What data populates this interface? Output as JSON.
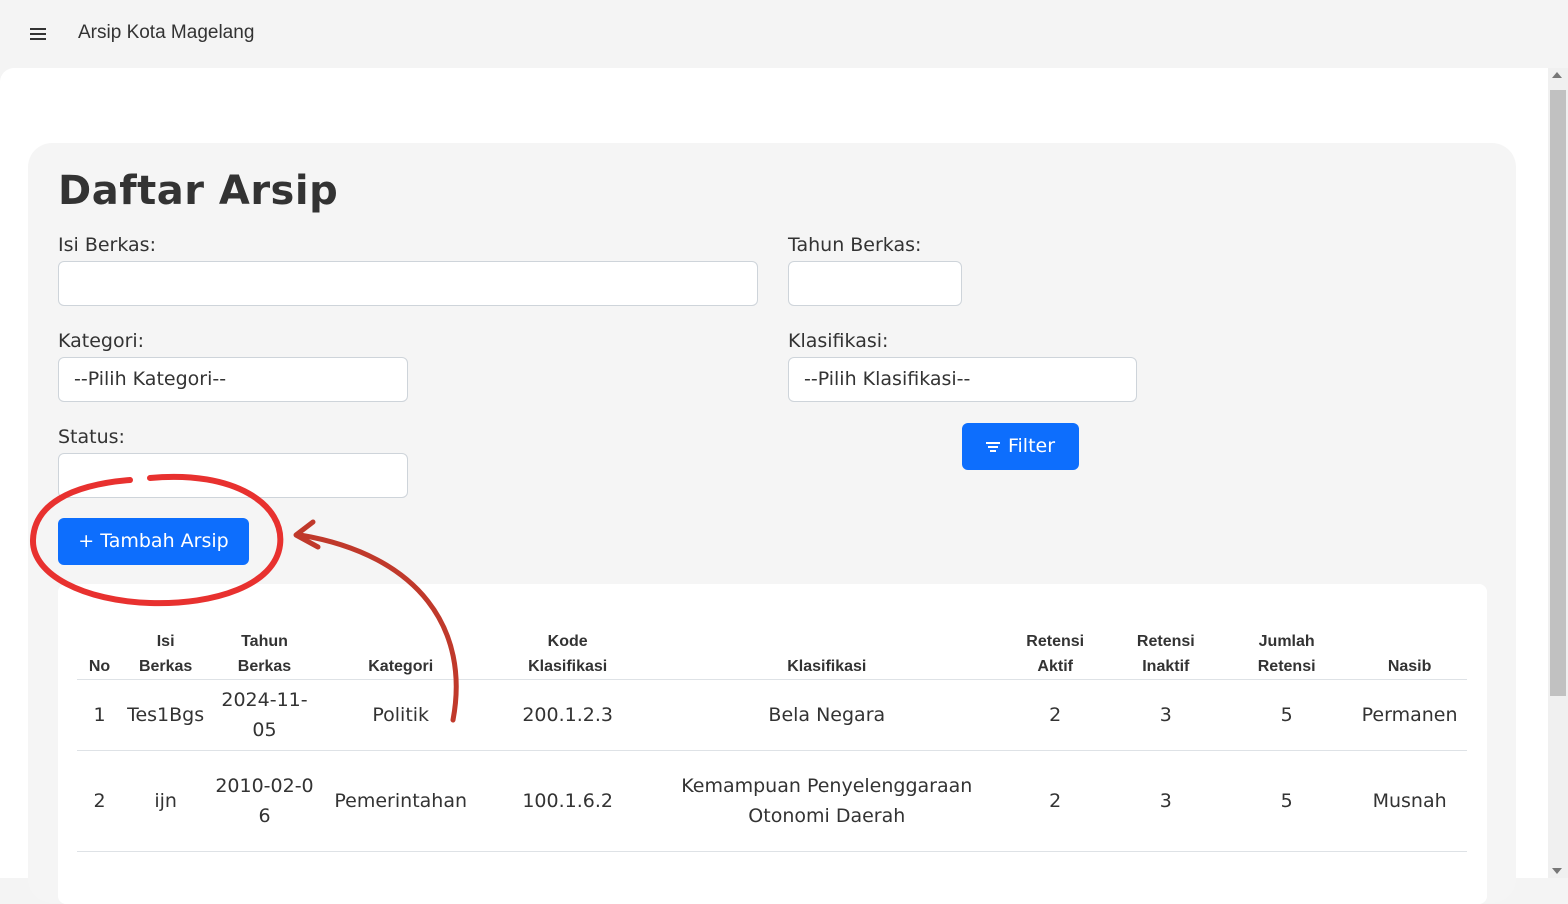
{
  "app": {
    "title": "Arsip Kota Magelang",
    "menu_icon": "hamburger-menu-icon"
  },
  "page": {
    "title": "Daftar Arsip"
  },
  "filters": {
    "isi_berkas": {
      "label": "Isi Berkas:",
      "value": ""
    },
    "tahun_berkas": {
      "label": "Tahun Berkas:",
      "value": ""
    },
    "kategori": {
      "label": "Kategori:",
      "selected": "--Pilih Kategori--"
    },
    "klasifikasi": {
      "label": "Klasifikasi:",
      "selected": "--Pilih Klasifikasi--"
    },
    "status": {
      "label": "Status:",
      "value": ""
    },
    "filter_button": {
      "label": "Filter",
      "icon": "filter-icon"
    }
  },
  "add_button": {
    "label": "+ Tambah Arsip"
  },
  "table": {
    "headers": {
      "no": "No",
      "isi_1": "Isi",
      "isi_2": "Berkas",
      "tahun_1": "Tahun",
      "tahun_2": "Berkas",
      "kategori": "Kategori",
      "kode_1": "Kode",
      "kode_2": "Klasifikasi",
      "klasifikasi": "Klasifikasi",
      "ret_aktif_1": "Retensi",
      "ret_aktif_2": "Aktif",
      "ret_inaktif_1": "Retensi",
      "ret_inaktif_2": "Inaktif",
      "jumlah_1": "Jumlah",
      "jumlah_2": "Retensi",
      "nasib": "Nasib"
    },
    "rows": [
      {
        "no": "1",
        "isi": "Tes1Bgs",
        "tahun": "2024-11-05",
        "kategori": "Politik",
        "kode": "200.1.2.3",
        "klasifikasi": "Bela Negara",
        "retensi_aktif": "2",
        "retensi_inaktif": "3",
        "jumlah_retensi": "5",
        "nasib": "Permanen"
      },
      {
        "no": "2",
        "isi": "ijn",
        "tahun": "2010-02-06",
        "kategori": "Pemerintahan",
        "kode": "100.1.6.2",
        "klasifikasi": "Kemampuan Penyelenggaraan Otonomi Daerah",
        "retensi_aktif": "2",
        "retensi_inaktif": "3",
        "jumlah_retensi": "5",
        "nasib": "Musnah"
      }
    ]
  },
  "colors": {
    "primary": "#0d6efd",
    "annotation": "#e8312f",
    "annotation_arrow": "#c0392b"
  }
}
